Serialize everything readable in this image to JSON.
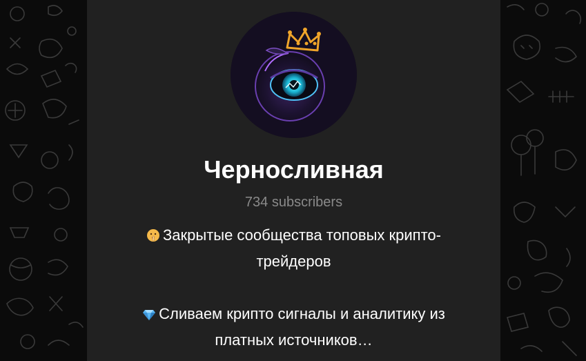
{
  "channel": {
    "title": "Черносливная",
    "subscribers": "734 subscribers",
    "avatar_icon": "crowned-eye-plum-icon"
  },
  "description": {
    "line1": "Закрытые сообщества топовых крипто-трейдеров",
    "line1_emoji": "shushing-face-icon",
    "line2": "Сливаем крипто сигналы и аналитику из платных источников…",
    "line2_emoji": "gem-icon"
  },
  "colors": {
    "card_background": "#212121",
    "page_background": "#0b0b0b",
    "subscribers_text": "#8a8a8a",
    "crown_accent": "#f0a52a",
    "eye_accent": "#33d6e8"
  }
}
